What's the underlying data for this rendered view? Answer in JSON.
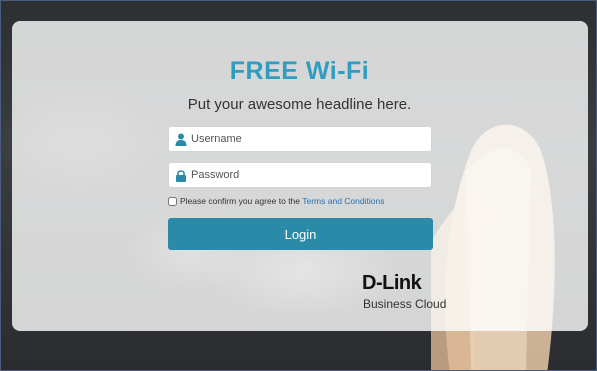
{
  "portal": {
    "title": "FREE Wi-Fi",
    "headline": "Put your awesome headline here.",
    "username_placeholder": "Username",
    "password_placeholder": "Password",
    "consent_prefix": "Please confirm you agree to the",
    "terms_link": "Terms and Conditions",
    "login_label": "Login",
    "title_color": "#2e9dc0",
    "button_color": "#2b8aa8"
  },
  "brand": {
    "logo": "D-Link",
    "tagline": "Business Cloud"
  },
  "icons": {
    "username": "user-icon",
    "password": "lock-icon"
  }
}
